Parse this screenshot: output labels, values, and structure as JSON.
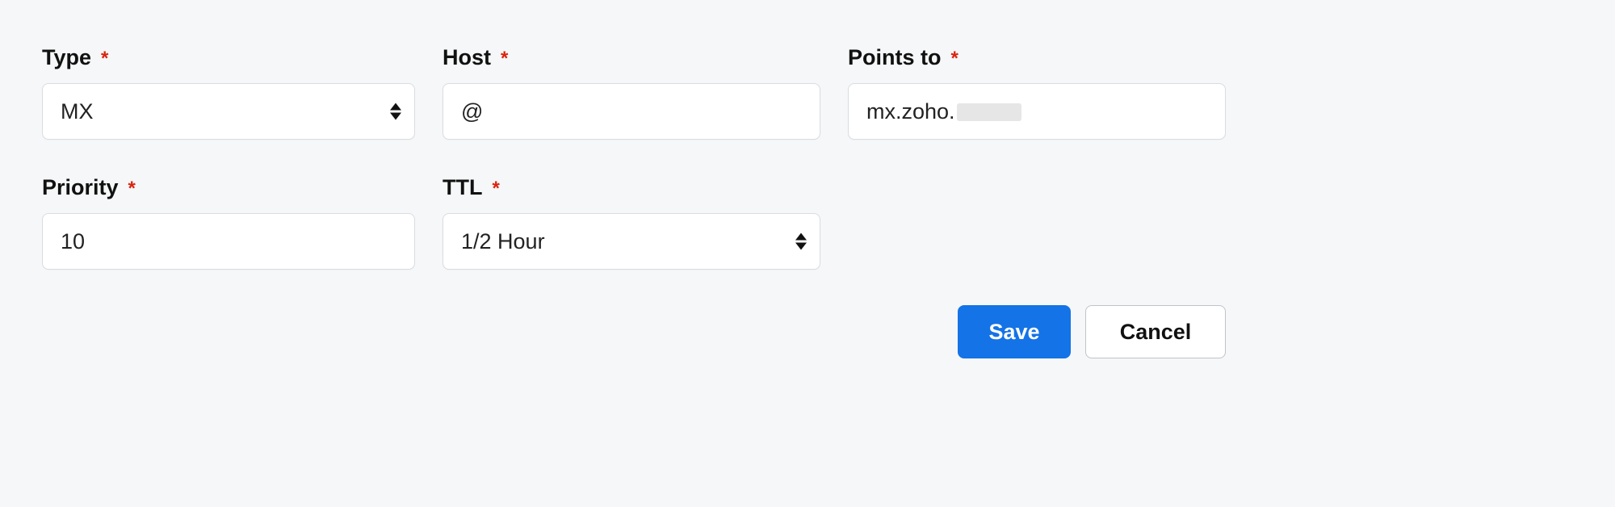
{
  "fields": {
    "type": {
      "label": "Type",
      "value": "MX"
    },
    "host": {
      "label": "Host",
      "value": "@"
    },
    "points_to": {
      "label": "Points to",
      "value": "mx.zoho."
    },
    "priority": {
      "label": "Priority",
      "value": "10"
    },
    "ttl": {
      "label": "TTL",
      "value": "1/2 Hour"
    }
  },
  "buttons": {
    "save": "Save",
    "cancel": "Cancel"
  },
  "required_marker": "*"
}
